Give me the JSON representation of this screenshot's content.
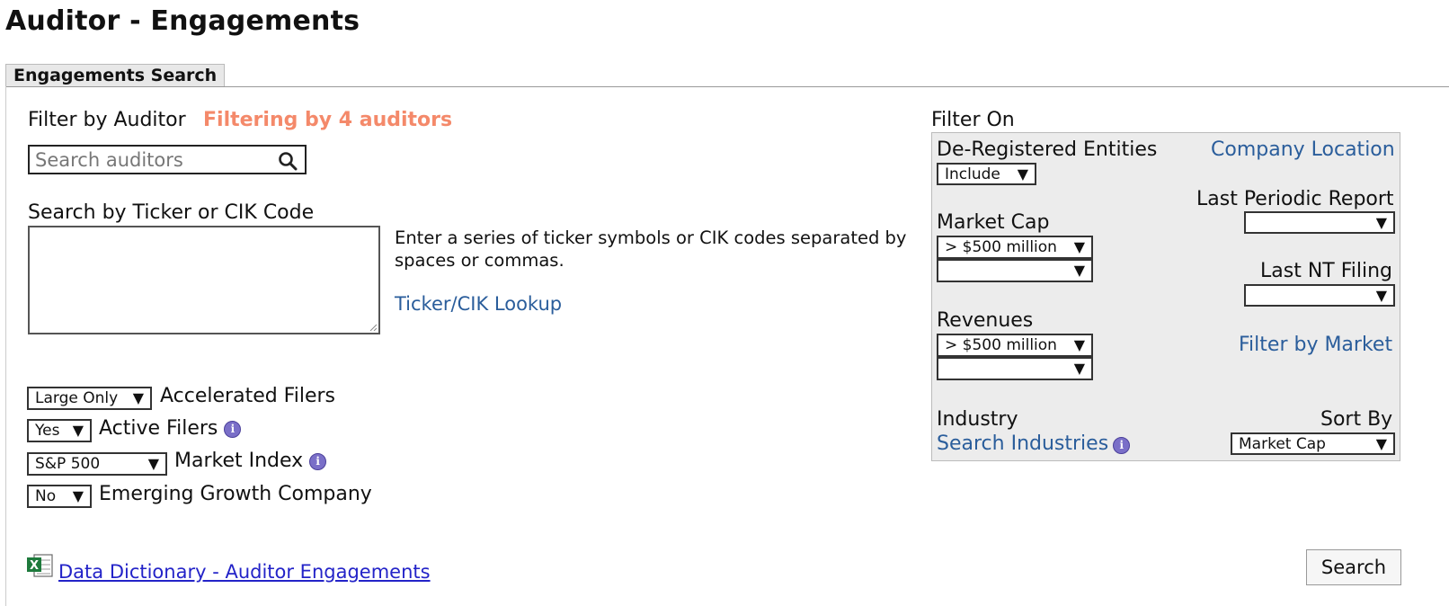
{
  "page": {
    "title": "Auditor - Engagements"
  },
  "tabs": [
    {
      "label": "Engagements Search"
    }
  ],
  "auditor_filter": {
    "label": "Filter by Auditor",
    "status": "Filtering by 4 auditors",
    "placeholder": "Search auditors"
  },
  "ticker_search": {
    "label": "Search by Ticker or CIK Code",
    "help": "Enter a series of ticker symbols or CIK codes separated by spaces or commas.",
    "lookup_link": "Ticker/CIK Lookup"
  },
  "left_filters": [
    {
      "value": "Large Only",
      "label": "Accelerated Filers"
    },
    {
      "value": "Yes",
      "label": "Active Filers"
    },
    {
      "value": "S&P 500",
      "label": "Market Index"
    },
    {
      "value": "No",
      "label": "Emerging Growth Company"
    }
  ],
  "filter_on": {
    "title": "Filter On",
    "deregistered": {
      "label": "De-Registered Entities",
      "value": "Include"
    },
    "company_location_link": "Company Location",
    "last_periodic_report": {
      "label": "Last Periodic Report",
      "value": ""
    },
    "market_cap": {
      "label": "Market Cap",
      "value1": "> $500 million",
      "value2": ""
    },
    "last_nt_filing": {
      "label": "Last NT Filing",
      "value": ""
    },
    "revenues": {
      "label": "Revenues",
      "value1": "> $500 million",
      "value2": ""
    },
    "filter_by_market_link": "Filter by Market",
    "industry": {
      "label": "Industry",
      "link": "Search Industries"
    },
    "sort_by": {
      "label": "Sort By",
      "value": "Market Cap"
    }
  },
  "footer": {
    "data_dictionary_link": "Data Dictionary - Auditor Engagements",
    "search_button": "Search"
  },
  "icons": [
    "search-icon",
    "info-icon",
    "excel-icon",
    "chevron-down-icon"
  ],
  "colors": {
    "accent_orange": "#f4896a",
    "link_blue": "#2a5d9b",
    "panel_bg": "#ececec"
  }
}
